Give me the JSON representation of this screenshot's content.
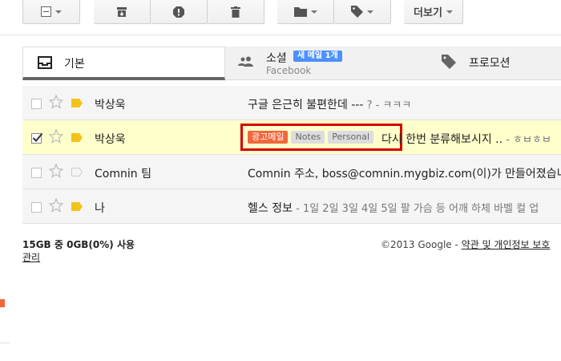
{
  "toolbar": {
    "more_label": "더보기",
    "icons": [
      "checkbox-dropdown",
      "archive-icon",
      "report-spam-icon",
      "delete-icon",
      "folder-icon",
      "label-icon"
    ]
  },
  "tabs": [
    {
      "label": "기본",
      "icon": "inbox-icon",
      "active": true
    },
    {
      "label": "소셜",
      "sub": "Facebook",
      "badge": "새 메일 1개",
      "icon": "people-icon"
    },
    {
      "label": "프로모션",
      "icon": "tag-icon"
    }
  ],
  "rows": [
    {
      "sender": "박상욱",
      "subject": "구글 은근히 불편한데 ---",
      "snippet": " ? - ㅋㅋㅋ",
      "checked": false,
      "important": true
    },
    {
      "sender": "박상욱",
      "labels": [
        "광고메일",
        "Notes",
        "Personal"
      ],
      "subject": "다시 한번 분류해보시지 ..",
      "snippet": " - ㅎㅂㅎㅂ",
      "checked": true,
      "important": true
    },
    {
      "sender": "Comnin 팀",
      "subject": "Comnin 주소, boss@comnin.mygbiz.com(이)가 만들어졌습니다",
      "snippet": "",
      "checked": false,
      "important": false
    },
    {
      "sender": "나",
      "subject": "헬스 정보",
      "snippet": " - 1일 2일 3일 4일 5일 팔 가슴 등 어깨 하체 바벨 컬 업",
      "checked": false,
      "important": true
    }
  ],
  "footer": {
    "storage": "15GB 중 0GB(0%) 사용",
    "manage": "관리",
    "copyright": "©2013 Google - ",
    "terms": "약관 및 개인정보 보호"
  },
  "colors": {
    "ad_label": "#f2673b",
    "highlight_border": "#d40000",
    "selected_row": "#ffffcc",
    "badge": "#4d90fe",
    "important_marker": "#f2c31b"
  }
}
